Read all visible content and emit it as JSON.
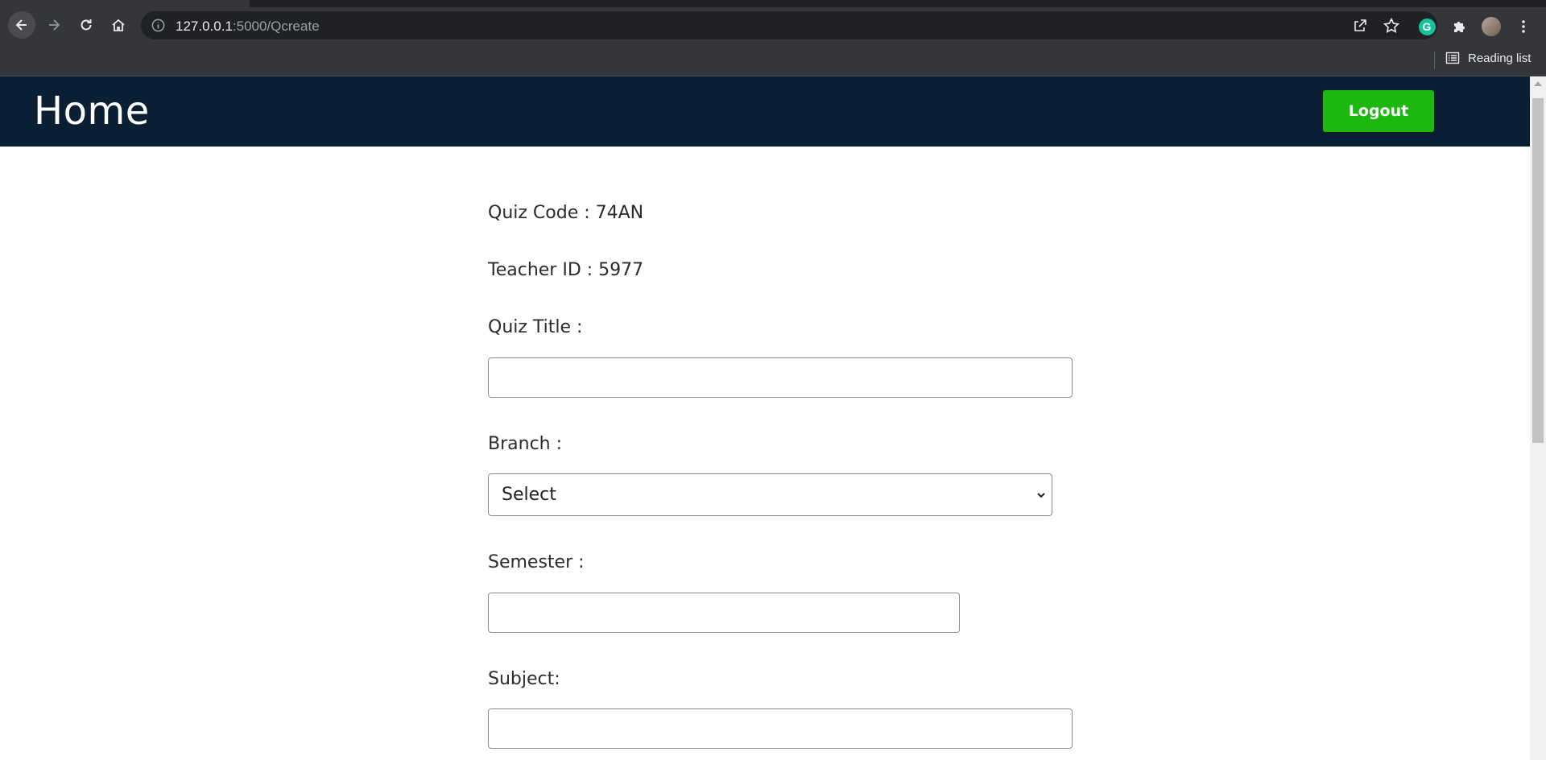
{
  "browser": {
    "url_host": "127.0.0.1",
    "url_rest": ":5000/Qcreate",
    "reading_list_label": "Reading list",
    "extension_letter": "G"
  },
  "navbar": {
    "brand": "Home",
    "logout_label": "Logout"
  },
  "form": {
    "quiz_code_label": "Quiz Code : 74AN",
    "teacher_id_label": "Teacher ID : 5977",
    "quiz_title_label": "Quiz Title :",
    "quiz_title_value": "",
    "branch_label": "Branch :",
    "branch_selected": "Select",
    "semester_label": "Semester :",
    "semester_value": "",
    "subject_label": "Subject:",
    "subject_value": ""
  },
  "colors": {
    "navbar_bg": "#0a1f33",
    "logout_bg": "#1db80f",
    "chrome_bg": "#35363a"
  }
}
